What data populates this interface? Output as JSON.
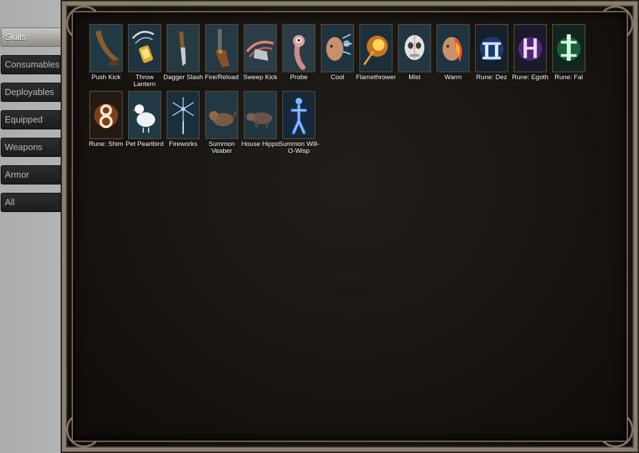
{
  "sidebar": {
    "tabs": [
      {
        "label": "Skills",
        "active": true
      },
      {
        "label": "Consumables",
        "active": false
      },
      {
        "label": "Deployables",
        "active": false
      },
      {
        "label": "Equipped",
        "active": false
      },
      {
        "label": "Weapons",
        "active": false
      },
      {
        "label": "Armor",
        "active": false
      },
      {
        "label": "All",
        "active": false
      }
    ]
  },
  "skills": [
    {
      "label": "Push Kick",
      "icon": "boot-icon",
      "bg": "#1f3a44"
    },
    {
      "label": "Throw Lantern",
      "icon": "lantern-icon",
      "bg": "#1e3440"
    },
    {
      "label": "Dagger Slash",
      "icon": "dagger-icon",
      "bg": "#243b42"
    },
    {
      "label": "Fire/Reload",
      "icon": "pistol-icon",
      "bg": "#243a45"
    },
    {
      "label": "Sweep Kick",
      "icon": "sweep-boot-icon",
      "bg": "#2a3d48"
    },
    {
      "label": "Probe",
      "icon": "probe-worm-icon",
      "bg": "#2a3c46"
    },
    {
      "label": "Cool",
      "icon": "frost-face-icon",
      "bg": "#1e3540"
    },
    {
      "label": "Flamethrower",
      "icon": "flame-burst-icon",
      "bg": "#1c2f3a"
    },
    {
      "label": "Mist",
      "icon": "skull-face-icon",
      "bg": "#213842"
    },
    {
      "label": "Warm",
      "icon": "fire-face-icon",
      "bg": "#1e3440"
    },
    {
      "label": "Rune: Dez",
      "icon": "rune-dez-icon",
      "bg": "#14202a"
    },
    {
      "label": "Rune: Egoth",
      "icon": "rune-egoth-icon",
      "bg": "#1a1a2a"
    },
    {
      "label": "Rune: Fal",
      "icon": "rune-fal-icon",
      "bg": "#13241e"
    },
    {
      "label": "Rune: Shim",
      "icon": "rune-shim-icon",
      "bg": "#241a14"
    },
    {
      "label": "Pet Pearlbird",
      "icon": "pearlbird-icon",
      "bg": "#203a46"
    },
    {
      "label": "Fireworks",
      "icon": "fireworks-icon",
      "bg": "#1a2f3c"
    },
    {
      "label": "Summon Veaber",
      "icon": "veaber-icon",
      "bg": "#223842"
    },
    {
      "label": "House Hippo",
      "icon": "hippo-icon",
      "bg": "#213741"
    },
    {
      "label": "Summon Will-O-Wisp",
      "icon": "wisp-icon",
      "bg": "#16283a"
    }
  ]
}
